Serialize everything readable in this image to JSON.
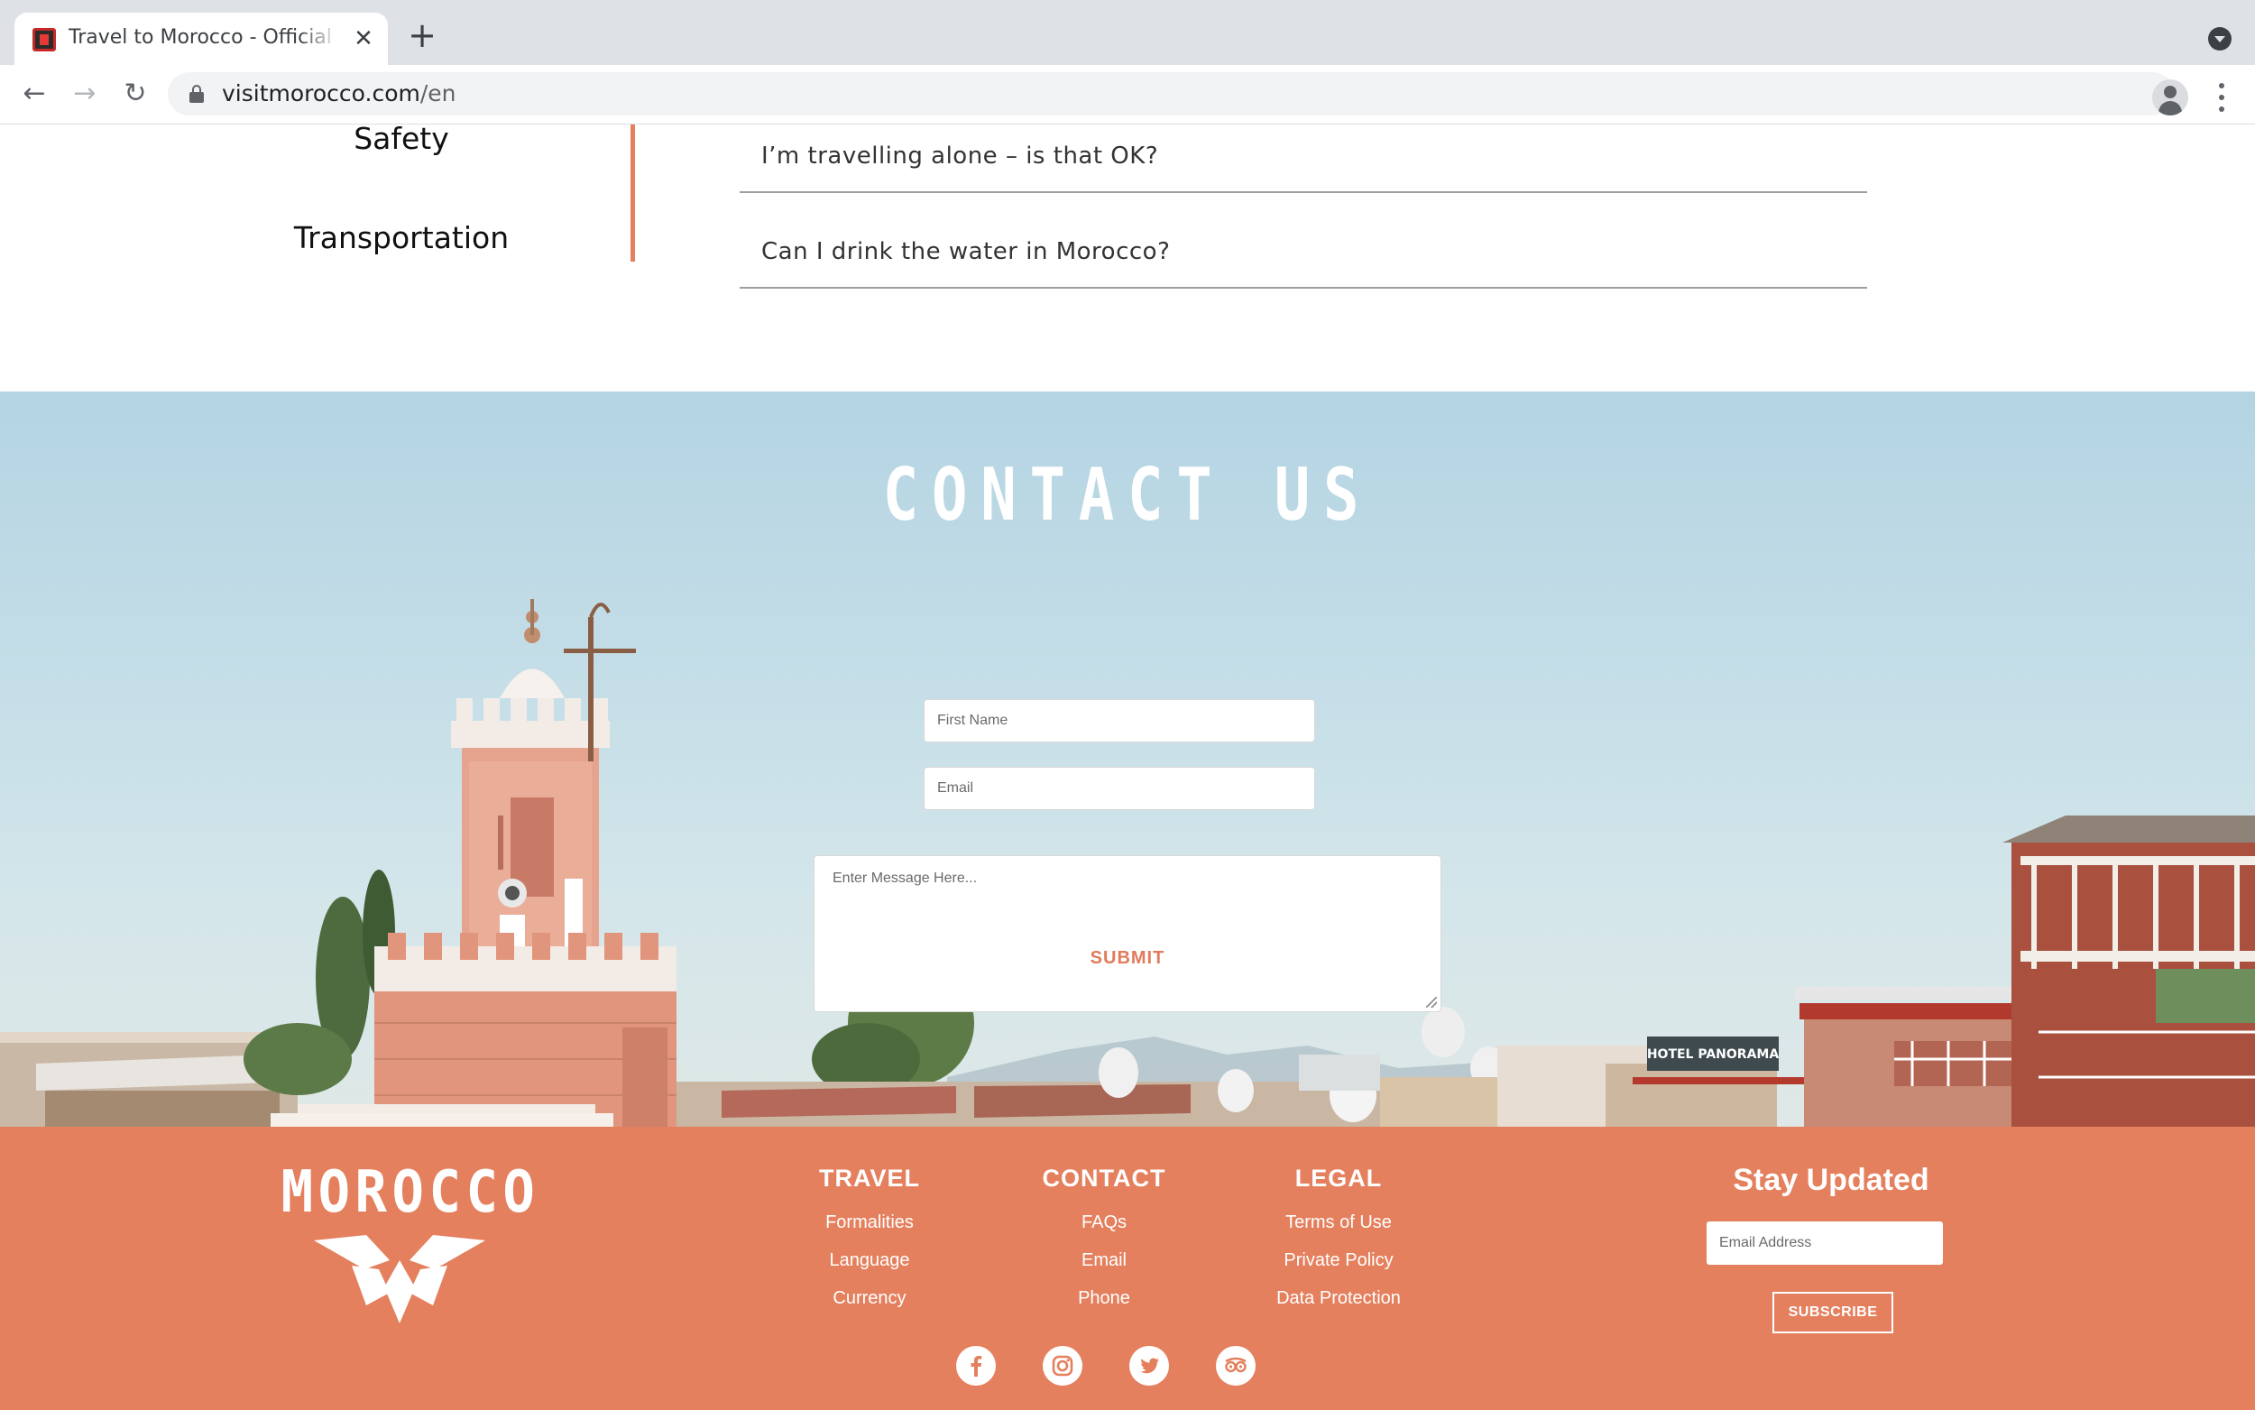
{
  "browser": {
    "tab_title": "Travel to Morocco - Official website",
    "close_glyph": "✕",
    "new_tab_glyph": "+",
    "back_glyph": "←",
    "forward_glyph": "→",
    "reload_glyph": "↻",
    "star_glyph": "☆",
    "url_host": "visitmorocco.com",
    "url_path": "/en"
  },
  "faq": {
    "categories": [
      "Safety",
      "Transportation"
    ],
    "questions": [
      "I’m travelling alone – is that OK?",
      "Can I drink the water in Morocco?"
    ],
    "accent_color": "#e5805e"
  },
  "contact": {
    "title": "CONTACT US",
    "first_name_placeholder": "First Name",
    "email_placeholder": "Email",
    "message_placeholder": "Enter Message Here...",
    "submit_label": "SUBMIT",
    "hotel_sign": "HOTEL PANORAMA"
  },
  "footer": {
    "logo": "MOROCCO",
    "columns": [
      {
        "title": "TRAVEL",
        "links": [
          "Formalities",
          "Language",
          "Currency"
        ]
      },
      {
        "title": "CONTACT",
        "links": [
          "FAQs",
          "Email",
          "Phone"
        ]
      },
      {
        "title": "LEGAL",
        "links": [
          "Terms of Use",
          "Private Policy",
          "Data Protection"
        ]
      }
    ],
    "stay_updated_title": "Stay Updated",
    "email_placeholder": "Email Address",
    "subscribe_label": "SUBSCRIBE",
    "social_icons": [
      "facebook-icon",
      "instagram-icon",
      "twitter-icon",
      "tripadvisor-icon"
    ],
    "background_color": "#e4805e"
  }
}
